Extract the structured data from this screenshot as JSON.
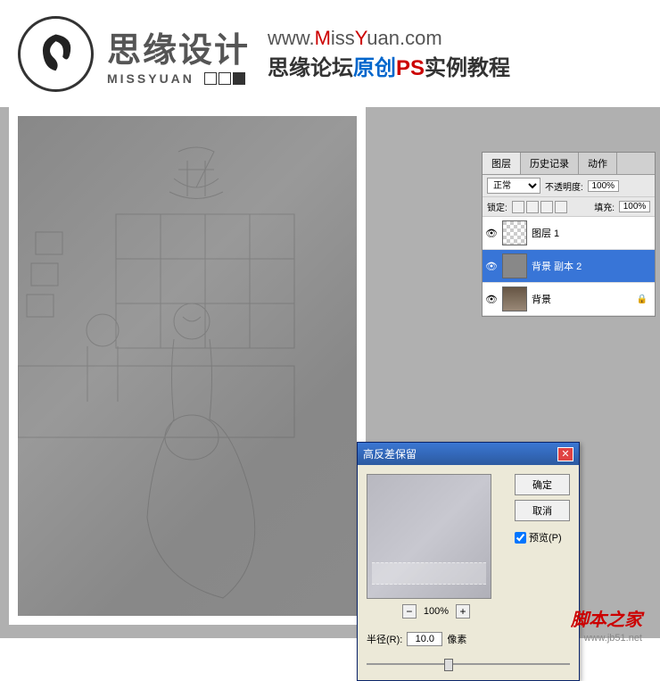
{
  "header": {
    "logo_cn": "思缘设计",
    "logo_en": "MISSYUAN",
    "url_prefix": "www.",
    "url_m": "M",
    "url_iss": "iss",
    "url_y": "Y",
    "url_suffix": "uan.com",
    "subtitle_pre": "思缘论坛",
    "subtitle_orig": "原创",
    "subtitle_ps": "PS",
    "subtitle_post": "实例教程"
  },
  "layers_panel": {
    "tabs": [
      "图层",
      "历史记录",
      "动作"
    ],
    "blend_mode": "正常",
    "opacity_label": "不透明度:",
    "opacity_value": "100%",
    "lock_label": "锁定:",
    "fill_label": "填充:",
    "fill_value": "100%",
    "layers": [
      {
        "name": "图层 1",
        "selected": false,
        "thumb": "checker"
      },
      {
        "name": "背景 副本 2",
        "selected": true,
        "thumb": "gray"
      },
      {
        "name": "背景",
        "selected": false,
        "thumb": "photo",
        "locked": true
      }
    ]
  },
  "dialog": {
    "title": "高反差保留",
    "ok": "确定",
    "cancel": "取消",
    "preview_label": "预览(P)",
    "zoom_value": "100%",
    "radius_label": "半径(R):",
    "radius_value": "10.0",
    "radius_unit": "像素"
  },
  "watermark": {
    "text": "脚本之家",
    "url": "www.jb51.net"
  }
}
